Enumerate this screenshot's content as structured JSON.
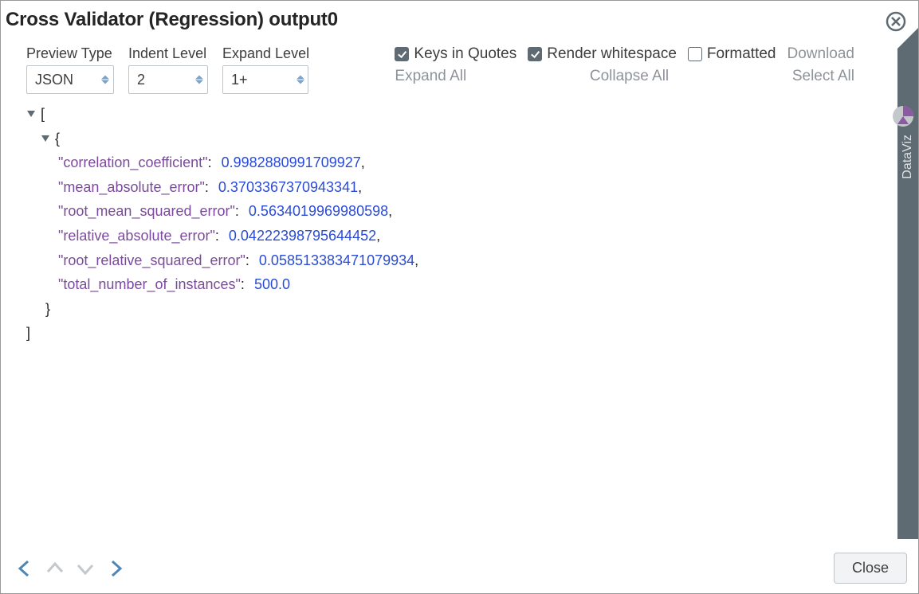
{
  "title": "Cross Validator (Regression) output0",
  "toolbar": {
    "preview_type": {
      "label": "Preview Type",
      "value": "JSON"
    },
    "indent_level": {
      "label": "Indent Level",
      "value": "2"
    },
    "expand_level": {
      "label": "Expand Level",
      "value": "1+"
    }
  },
  "options": {
    "keys_in_quotes": {
      "label": "Keys in Quotes",
      "checked": true
    },
    "render_whitespace": {
      "label": "Render whitespace",
      "checked": true
    },
    "formatted": {
      "label": "Formatted",
      "checked": false
    },
    "download": "Download",
    "expand_all": "Expand All",
    "collapse_all": "Collapse All",
    "select_all": "Select All"
  },
  "json_data": {
    "entries": [
      {
        "key": "\"correlation_coefficient\"",
        "value": "0.9982880991709927",
        "comma": ","
      },
      {
        "key": "\"mean_absolute_error\"",
        "value": "0.3703367370943341",
        "comma": ","
      },
      {
        "key": "\"root_mean_squared_error\"",
        "value": "0.5634019969980598",
        "comma": ","
      },
      {
        "key": "\"relative_absolute_error\"",
        "value": "0.04222398795644452",
        "comma": ","
      },
      {
        "key": "\"root_relative_squared_error\"",
        "value": "0.058513383471079934",
        "comma": ","
      },
      {
        "key": "\"total_number_of_instances\"",
        "value": "500.0",
        "comma": ""
      }
    ],
    "open_bracket": "[",
    "open_brace": "{",
    "close_brace": "}",
    "close_bracket": "]"
  },
  "footer": {
    "close_label": "Close"
  },
  "side_tab": {
    "label": "DataViz"
  }
}
